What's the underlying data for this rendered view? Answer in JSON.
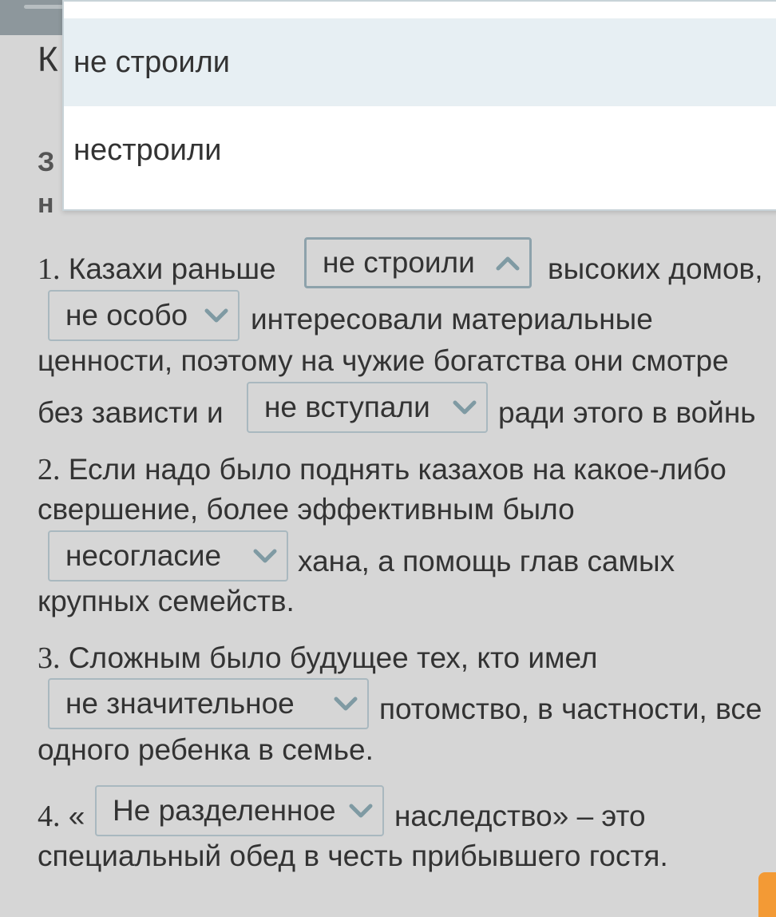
{
  "background": {
    "heading_letter": "К",
    "bold_line_1": "З",
    "bold_line_2": "н"
  },
  "dropdown_popup": {
    "options": [
      "не строили",
      "нестроили"
    ],
    "highlighted_index": 0
  },
  "exercise": {
    "items": [
      {
        "number": "1.",
        "line1_before": "Казахи раньше",
        "line1_after": "высоких домов,",
        "select1": {
          "value": "не строили",
          "state": "open"
        },
        "select2": {
          "value": "не особо",
          "state": "closed"
        },
        "line2_after": "интересовали материальные",
        "line3": "ценности, поэтому на чужие богатства они смотре",
        "line4_before": "без зависти и",
        "select3": {
          "value": "не вступали",
          "state": "closed"
        },
        "line4_after": "ради этого в войнь"
      },
      {
        "number": "2.",
        "line1": "Если надо было поднять казахов на какое-либо",
        "line2": "свершение, более эффективным было",
        "select1": {
          "value": "несогласие",
          "state": "closed"
        },
        "line3_after": "хана, а помощь глав самых",
        "line4": "крупных семейств."
      },
      {
        "number": "3.",
        "line1": "Сложным было будущее тех, кто имел",
        "select1": {
          "value": "не значительное",
          "state": "closed"
        },
        "line2_after": "потомство, в частности, все",
        "line3": "одного ребенка в семье."
      },
      {
        "number": "4.",
        "quote_open": "«",
        "select1": {
          "value": "Не разделенное",
          "state": "closed"
        },
        "line1_after": "наследство» – это",
        "line2": "специальный обед в честь прибывшего гостя."
      }
    ]
  },
  "colors": {
    "background": "#d6d6d6",
    "popup_highlight": "#e7eff3",
    "select_border": "#a9b8bf",
    "chevron": "#7f9aa3",
    "accent_orange": "#f39a35"
  },
  "icons": {
    "select_closed": "chevron-down-icon",
    "select_open": "chevron-up-icon"
  }
}
